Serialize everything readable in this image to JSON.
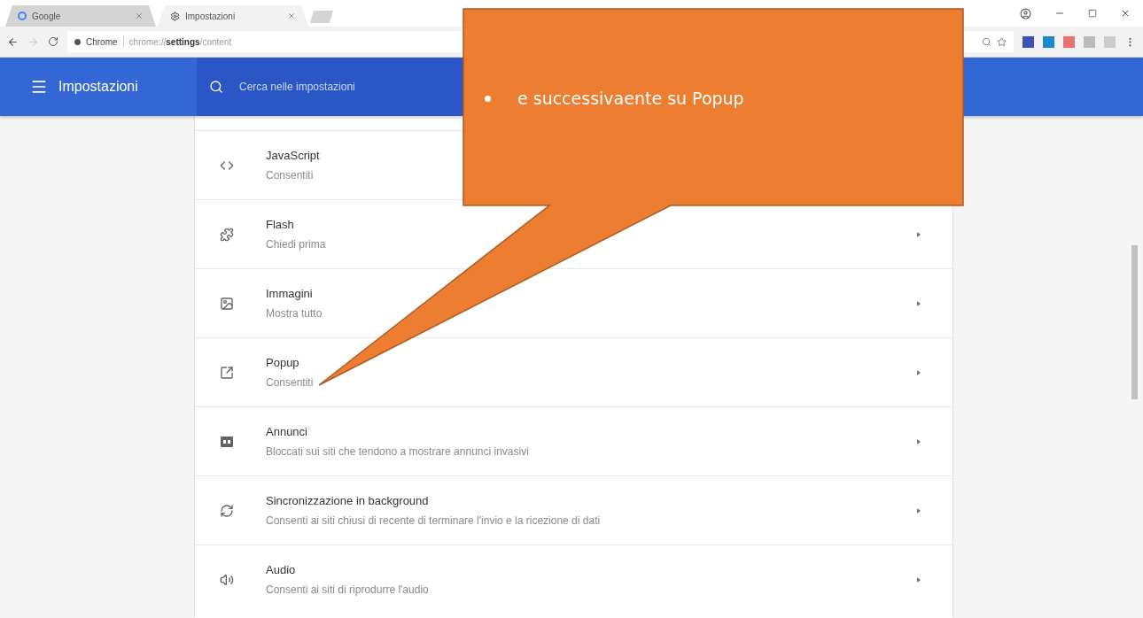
{
  "browser": {
    "tabs": [
      {
        "title": "Google",
        "selected": false
      },
      {
        "title": "Impostazioni",
        "selected": true
      }
    ],
    "address": {
      "site_label": "Chrome",
      "url": "chrome://**settings**/content"
    }
  },
  "header": {
    "title": "Impostazioni",
    "search_placeholder": "Cerca nelle impostazioni"
  },
  "settings": [
    {
      "title": "JavaScript",
      "subtitle": "Consentiti",
      "chevron": false
    },
    {
      "title": "Flash",
      "subtitle": "Chiedi prima",
      "chevron": true
    },
    {
      "title": "Immagini",
      "subtitle": "Mostra tutto",
      "chevron": true
    },
    {
      "title": "Popup",
      "subtitle": "Consentiti",
      "chevron": true
    },
    {
      "title": "Annunci",
      "subtitle": "Bloccati sui siti che tendono a mostrare annunci invasivi",
      "chevron": true
    },
    {
      "title": "Sincronizzazione in background",
      "subtitle": "Consenti ai siti chiusi di recente di terminare l'invio e la ricezione di dati",
      "chevron": true
    },
    {
      "title": "Audio",
      "subtitle": "Consenti ai siti di riprodurre l'audio",
      "chevron": true
    }
  ],
  "callout": {
    "text": "e successivaente su Popup"
  }
}
